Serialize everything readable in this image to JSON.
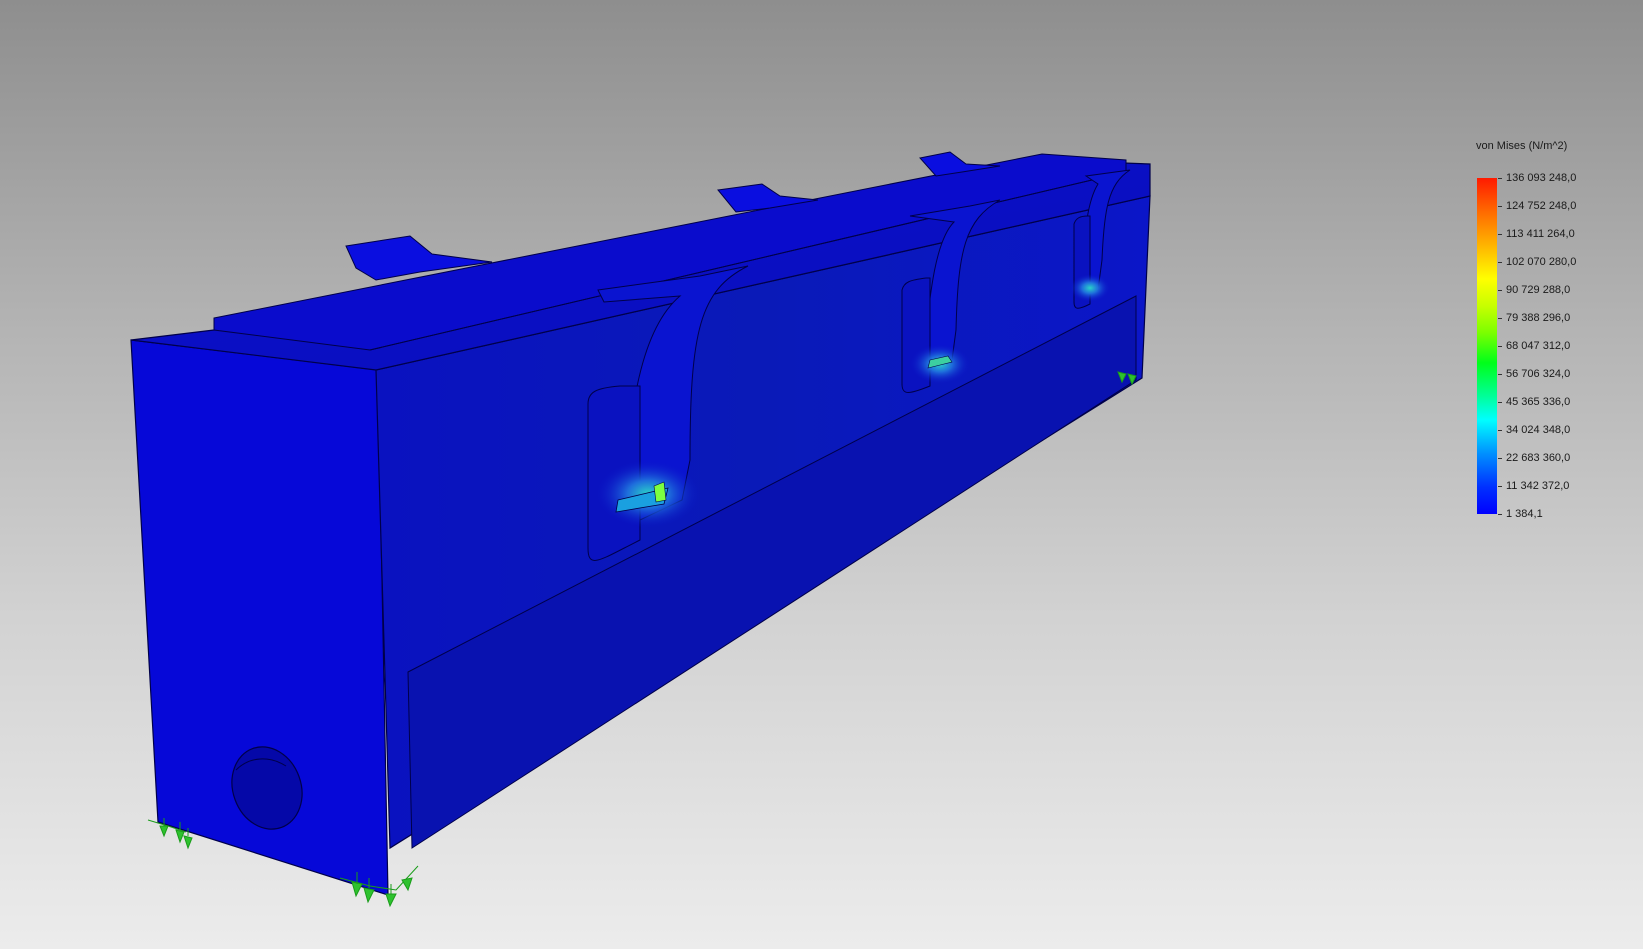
{
  "legend": {
    "title": "von Mises (N/m^2)",
    "values": [
      "136 093 248,0",
      "124 752 248,0",
      "113 411 264,0",
      "102 070 280,0",
      "90 729 288,0",
      "79 388 296,0",
      "68 047 312,0",
      "56 706 324,0",
      "45 365 336,0",
      "34 024 348,0",
      "22 683 360,0",
      "11 342 372,0",
      "1 384,1"
    ]
  },
  "colors": {
    "model_base": "#0a10c4",
    "model_dark": "#0608a0",
    "model_light": "#1420e0",
    "fixture_arrow": "#2ec22e",
    "background_top": "#8e8e8e",
    "background_bottom": "#ececec"
  }
}
